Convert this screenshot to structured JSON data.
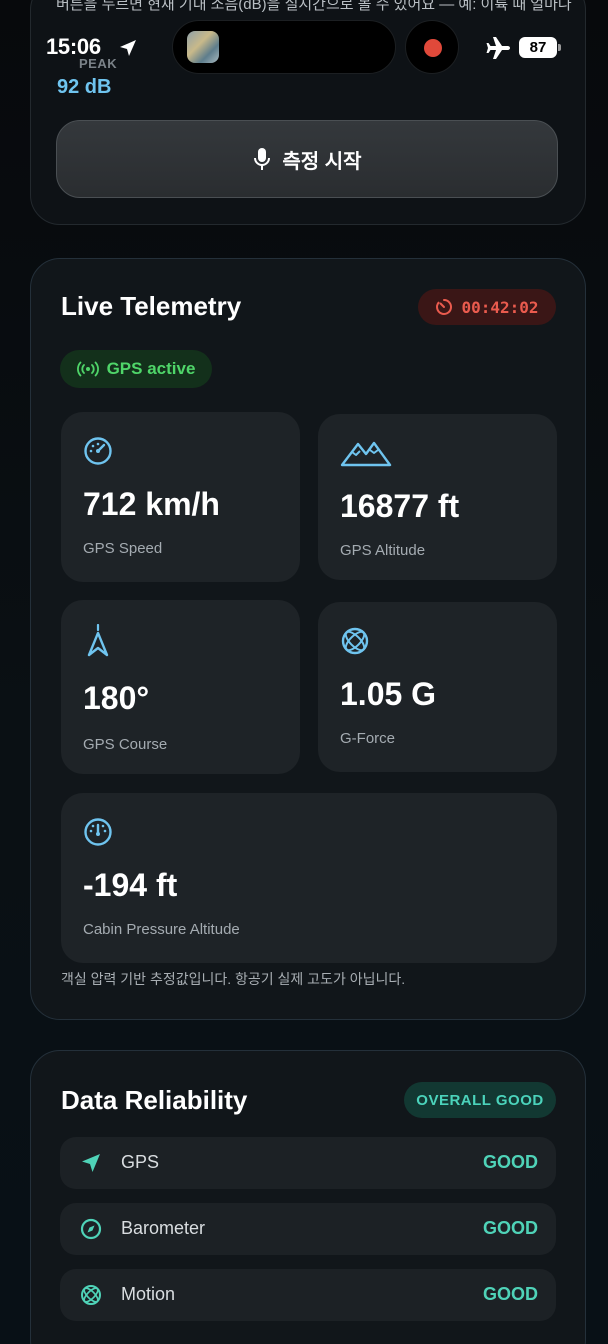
{
  "intro": {
    "text": "버튼을 누르면 현재 기내 소음(dB)을 실시간으로 볼 수 있어요 — 예: 이륙 때 얼마나 시끄러운지, 소리는 녹음되지 않아요."
  },
  "status_bar": {
    "time": "15:06",
    "battery": "87"
  },
  "noise": {
    "peak_label": "PEAK",
    "peak_value": "92 dB",
    "measure_button": "측정 시작"
  },
  "telemetry": {
    "title": "Live Telemetry",
    "timer": "00:42:02",
    "gps_status": "GPS active",
    "tiles": [
      {
        "value": "712 km/h",
        "label": "GPS Speed",
        "icon": "speedometer-icon"
      },
      {
        "value": "16877 ft",
        "label": "GPS Altitude",
        "icon": "mountains-icon"
      },
      {
        "value": "180°",
        "label": "GPS Course",
        "icon": "compass-needle-icon"
      },
      {
        "value": "1.05 G",
        "label": "G-Force",
        "icon": "gyroscope-icon"
      },
      {
        "value": "-194 ft",
        "label": "Cabin Pressure Altitude",
        "icon": "gauge-icon"
      }
    ],
    "note": "객실 압력 기반 추정값입니다. 항공기 실제 고도가 아닙니다."
  },
  "reliability": {
    "title": "Data Reliability",
    "overall": "OVERALL GOOD",
    "rows": [
      {
        "name": "GPS",
        "status": "GOOD",
        "icon": "location-arrow-icon"
      },
      {
        "name": "Barometer",
        "status": "GOOD",
        "icon": "compass-icon"
      },
      {
        "name": "Motion",
        "status": "GOOD",
        "icon": "gyroscope-icon"
      }
    ]
  },
  "colors": {
    "accent_blue": "#6fc4ef",
    "timer_red": "#ea5b4e",
    "gps_green": "#4fd569",
    "good_teal": "#4fd3b8"
  }
}
